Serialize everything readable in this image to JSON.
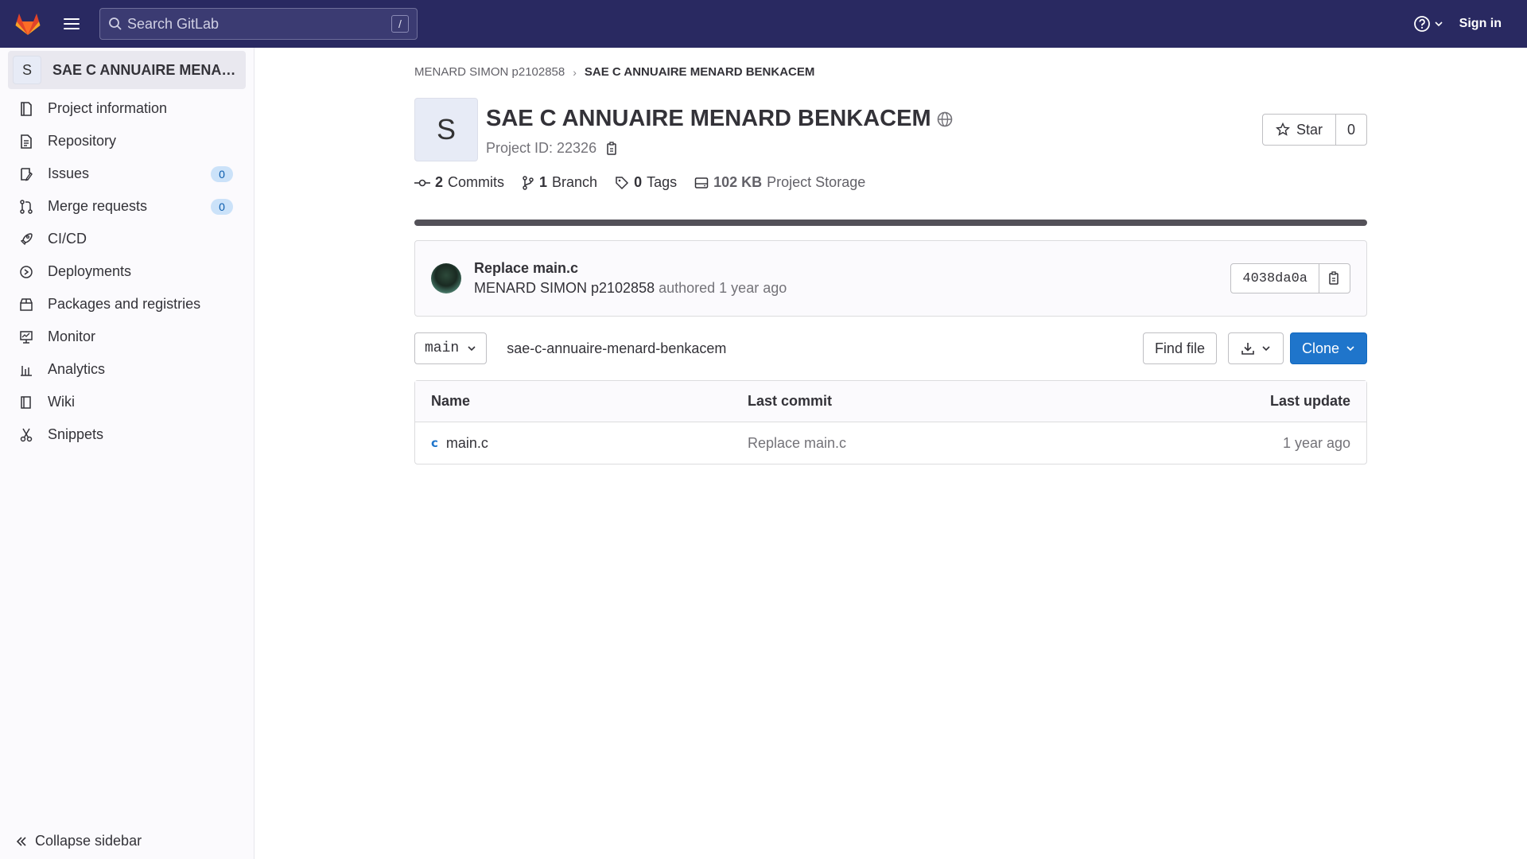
{
  "topbar": {
    "search_placeholder": "Search GitLab",
    "search_shortcut": "/",
    "sign_in": "Sign in"
  },
  "sidebar": {
    "context_avatar": "S",
    "context_title": "SAE C ANNUAIRE MENARD BENKACEM",
    "items": [
      {
        "label": "Project information",
        "icon": "project-icon"
      },
      {
        "label": "Repository",
        "icon": "doc-icon"
      },
      {
        "label": "Issues",
        "icon": "issues-icon",
        "badge": "0"
      },
      {
        "label": "Merge requests",
        "icon": "merge-request-icon",
        "badge": "0"
      },
      {
        "label": "CI/CD",
        "icon": "rocket-icon"
      },
      {
        "label": "Deployments",
        "icon": "deployments-icon"
      },
      {
        "label": "Packages and registries",
        "icon": "package-icon"
      },
      {
        "label": "Monitor",
        "icon": "monitor-icon"
      },
      {
        "label": "Analytics",
        "icon": "chart-icon"
      },
      {
        "label": "Wiki",
        "icon": "book-icon"
      },
      {
        "label": "Snippets",
        "icon": "snippet-icon"
      }
    ],
    "collapse_label": "Collapse sidebar"
  },
  "breadcrumb": {
    "parent": "MENARD SIMON p2102858",
    "current": "SAE C ANNUAIRE MENARD BENKACEM"
  },
  "project": {
    "avatar": "S",
    "title": "SAE C ANNUAIRE MENARD BENKACEM",
    "id_label": "Project ID: 22326",
    "star_label": "Star",
    "star_count": "0"
  },
  "stats": {
    "commits_count": "2",
    "commits_label": "Commits",
    "branch_count": "1",
    "branch_label": "Branch",
    "tags_count": "0",
    "tags_label": "Tags",
    "storage_size": "102 KB",
    "storage_label": "Project Storage"
  },
  "last_commit": {
    "title": "Replace main.c",
    "author": "MENARD SIMON p2102858",
    "authored": "authored 1 year ago",
    "sha": "4038da0a"
  },
  "toolbar": {
    "branch": "main",
    "path": "sae-c-annuaire-menard-benkacem",
    "find_file": "Find file",
    "clone": "Clone"
  },
  "files": {
    "headers": {
      "name": "Name",
      "last_commit": "Last commit",
      "last_update": "Last update"
    },
    "rows": [
      {
        "name": "main.c",
        "last_commit": "Replace main.c",
        "last_update": "1 year ago"
      }
    ]
  }
}
